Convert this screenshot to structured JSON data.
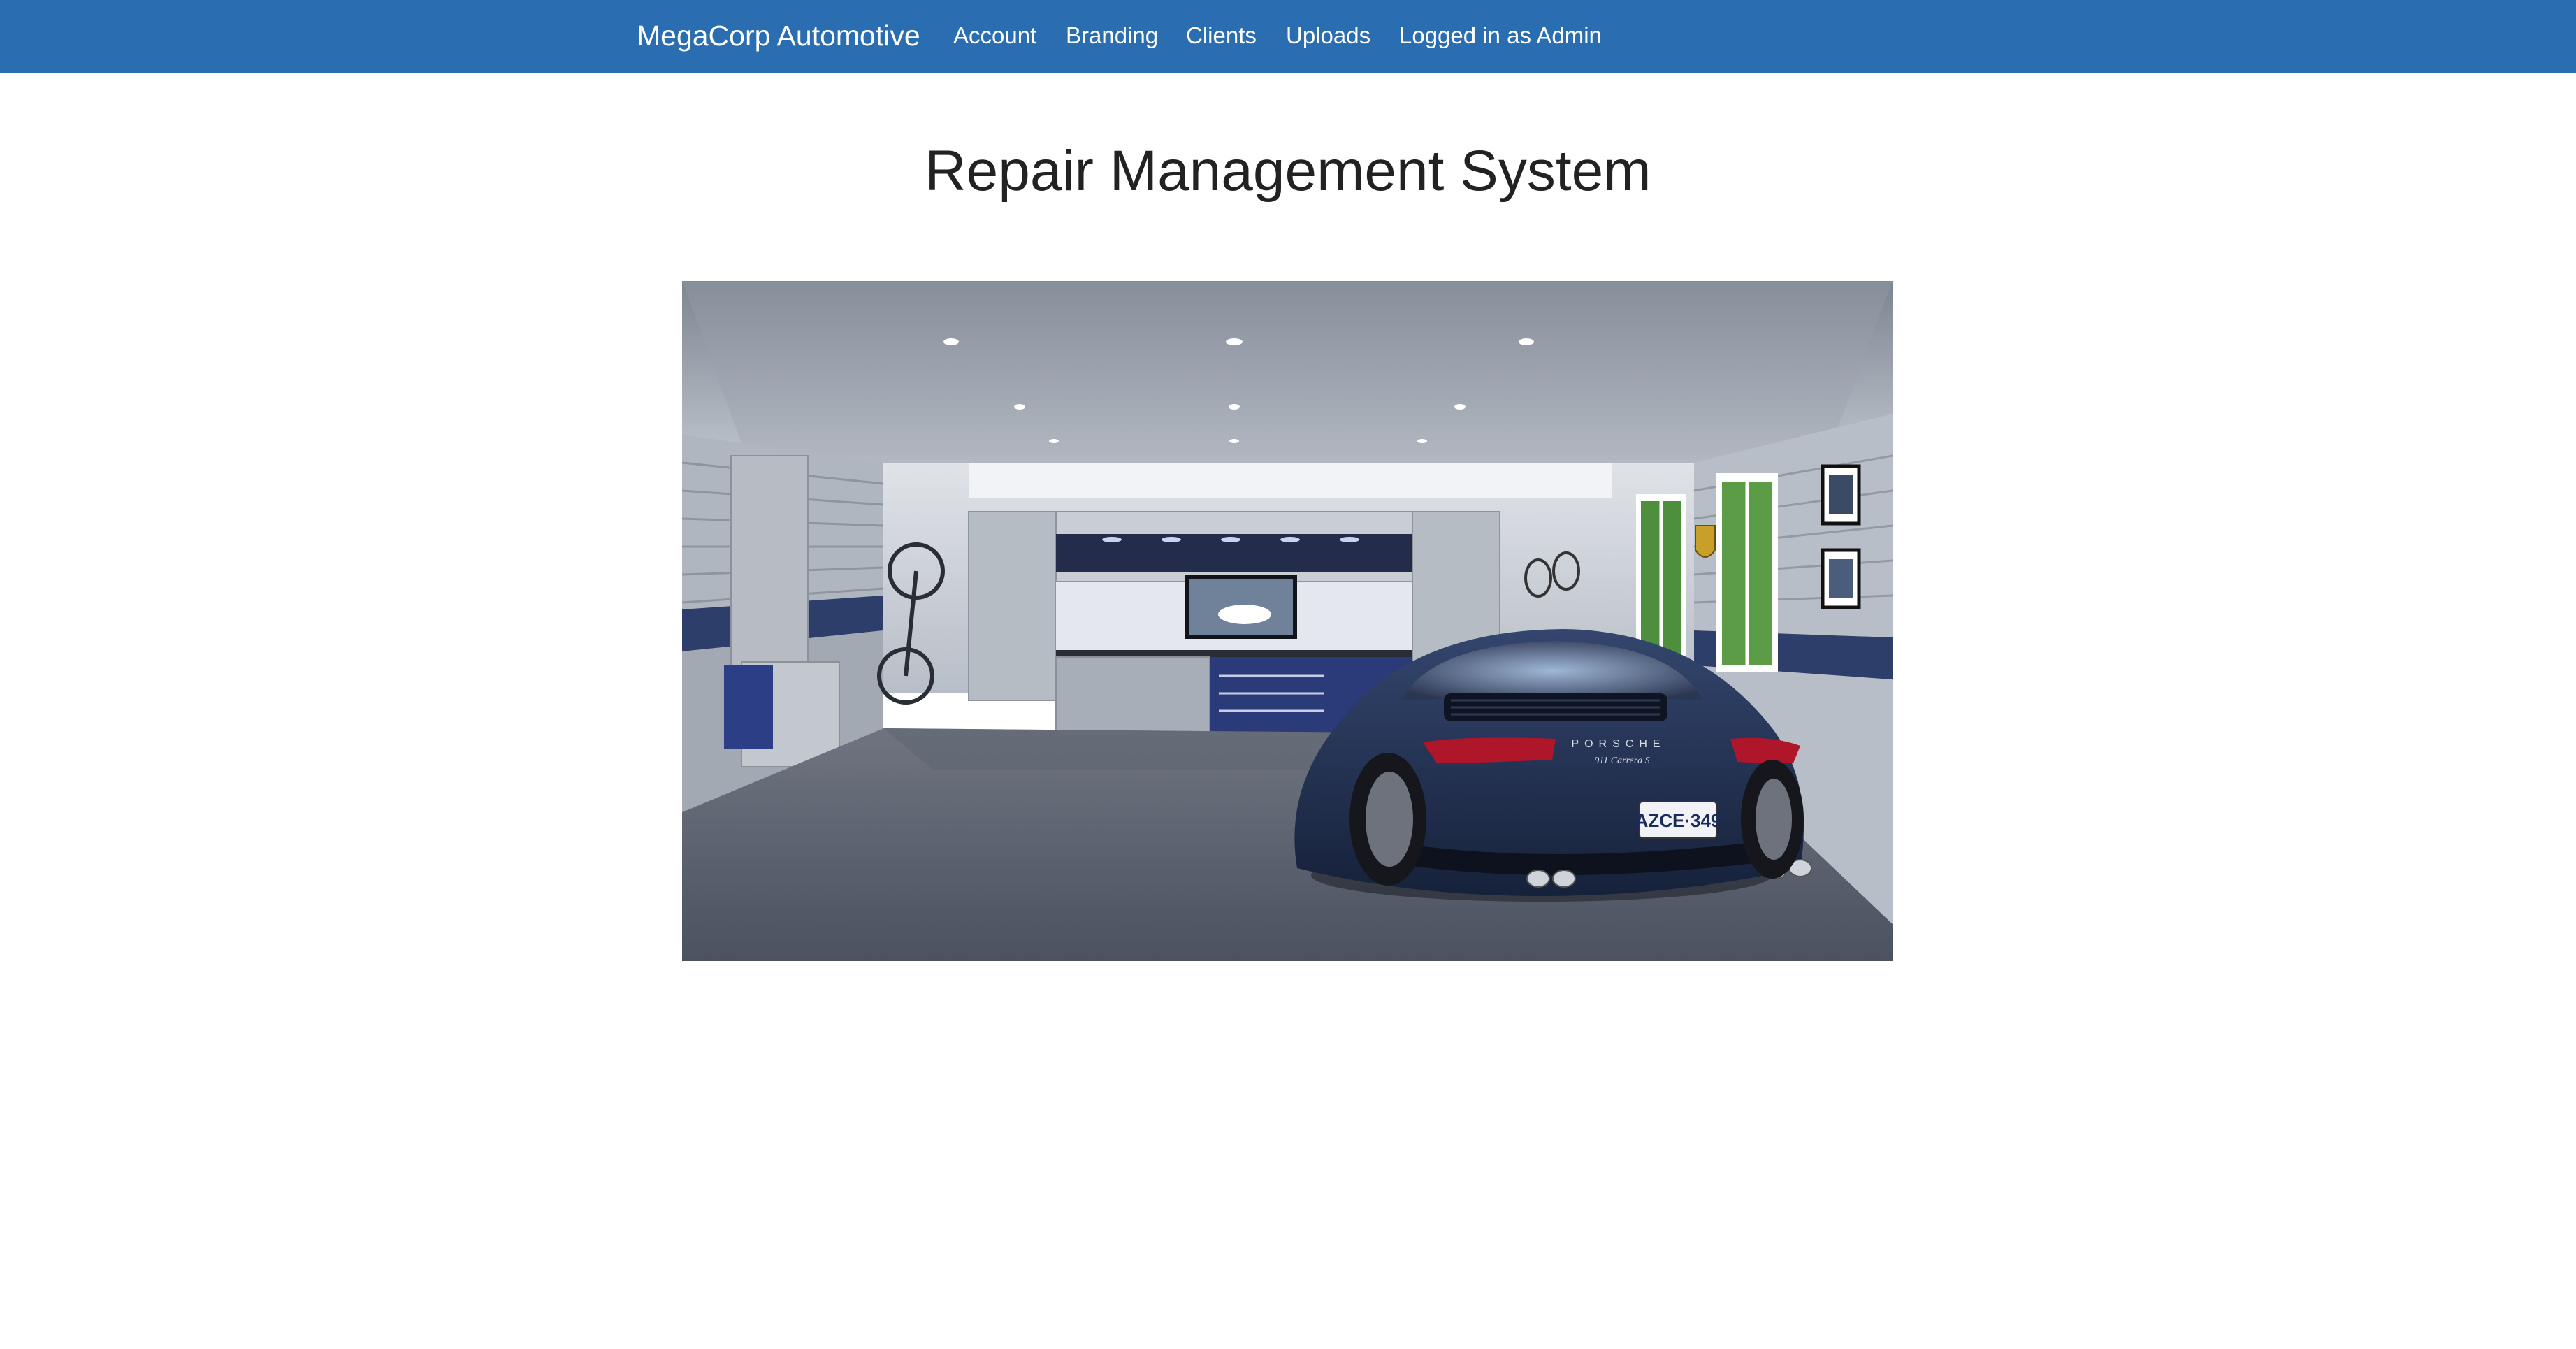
{
  "navbar": {
    "brand": "MegaCorp Automotive",
    "items": [
      {
        "label": "Account"
      },
      {
        "label": "Branding"
      },
      {
        "label": "Clients"
      },
      {
        "label": "Uploads"
      },
      {
        "label": "Logged in as Admin"
      }
    ],
    "background_color": "#2a6db0"
  },
  "main": {
    "title": "Repair Management System",
    "hero_image": {
      "plate_text": "AZCE·349",
      "car_badge_text": "PORSCHE",
      "car_model_text": "911 Carrera S"
    }
  }
}
